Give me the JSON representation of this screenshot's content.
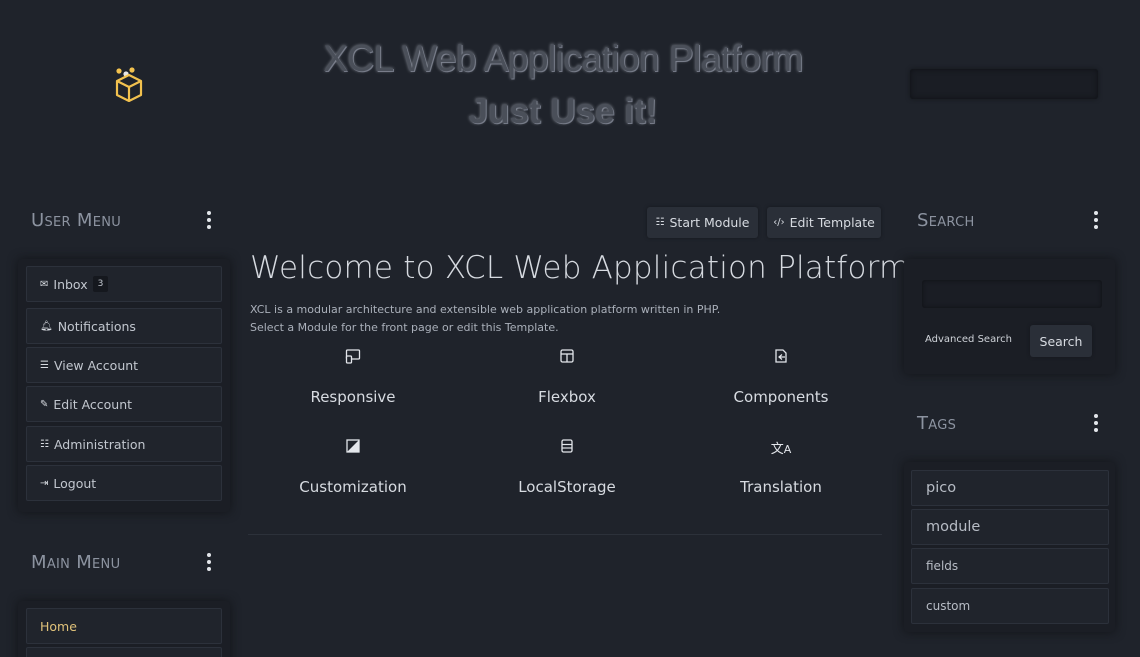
{
  "header": {
    "title": "XCL Web Application Platform",
    "slogan": "Just Use it!"
  },
  "user_menu": {
    "title": "User Menu",
    "items": [
      {
        "label": "Inbox",
        "icon": "mail-icon",
        "badge": "3"
      },
      {
        "label": "Notifications",
        "icon": "bell-icon"
      },
      {
        "label": "View Account",
        "icon": "id-card-icon"
      },
      {
        "label": "Edit Account",
        "icon": "user-edit-icon"
      },
      {
        "label": "Administration",
        "icon": "sliders-icon"
      },
      {
        "label": "Logout",
        "icon": "logout-icon"
      }
    ]
  },
  "main_menu": {
    "title": "Main Menu",
    "items": [
      {
        "label": "Home"
      }
    ]
  },
  "toolbar": {
    "start_module": "Start Module",
    "edit_template": "Edit Template"
  },
  "content": {
    "heading": "Welcome to XCL Web Application Platform",
    "line1": "XCL is a modular architecture and extensible web application platform written in PHP.",
    "line2": "Select a Module for the front page or edit this Template.",
    "features": [
      {
        "label": "Responsive",
        "icon": "responsive-icon"
      },
      {
        "label": "Flexbox",
        "icon": "layout-icon"
      },
      {
        "label": "Components",
        "icon": "components-icon"
      },
      {
        "label": "Customization",
        "icon": "contrast-icon"
      },
      {
        "label": "LocalStorage",
        "icon": "storage-icon"
      },
      {
        "label": "Translation",
        "icon": "translate-icon"
      }
    ]
  },
  "search": {
    "title": "Search",
    "advanced": "Advanced Search",
    "button": "Search"
  },
  "tags": {
    "title": "Tags",
    "items": [
      "pico",
      "module",
      "fields",
      "custom"
    ]
  },
  "colors": {
    "background": "#1f232b",
    "accent": "#e0c27a"
  }
}
